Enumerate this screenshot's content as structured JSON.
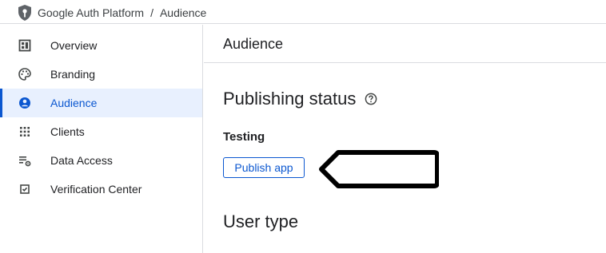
{
  "breadcrumb": {
    "app": "Google Auth Platform",
    "separator": "/",
    "page": "Audience"
  },
  "sidebar": {
    "items": [
      {
        "label": "Overview",
        "icon": "dashboard-icon",
        "active": false
      },
      {
        "label": "Branding",
        "icon": "palette-icon",
        "active": false
      },
      {
        "label": "Audience",
        "icon": "person-icon",
        "active": true
      },
      {
        "label": "Clients",
        "icon": "apps-grid-icon",
        "active": false
      },
      {
        "label": "Data Access",
        "icon": "data-settings-icon",
        "active": false
      },
      {
        "label": "Verification Center",
        "icon": "checkbox-icon",
        "active": false
      }
    ]
  },
  "main": {
    "header": "Audience",
    "publishing_status": {
      "title": "Publishing status",
      "status": "Testing",
      "button_label": "Publish app"
    },
    "user_type": {
      "title": "User type"
    }
  },
  "colors": {
    "accent": "#0b57d0",
    "active_bg": "#e8f0fe",
    "text": "#202124",
    "border": "#dadce0"
  }
}
